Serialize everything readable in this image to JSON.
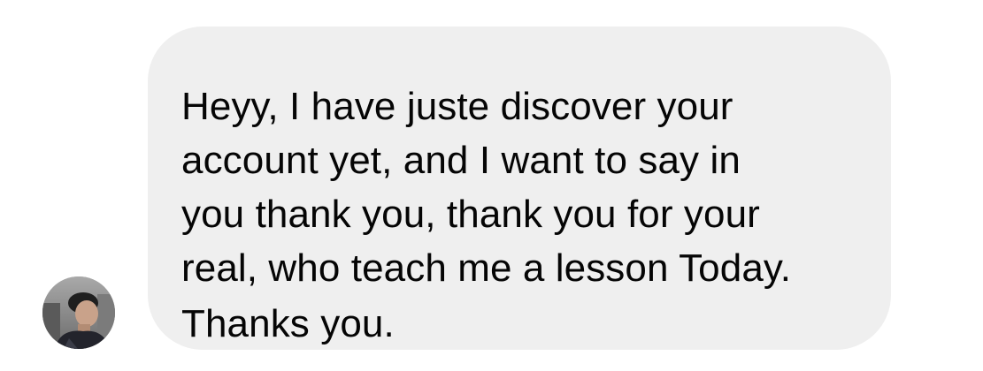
{
  "conversation": {
    "sender": {
      "avatar_icon": "user-avatar-photo"
    },
    "message": {
      "lines": [
        "Heyy, I have juste discover your",
        "account yet, and I want to say in",
        "you thank you, thank you for your",
        "real, who teach me a lesson Today.",
        "Thanks you."
      ]
    },
    "colors": {
      "bubble_background": "#efefef",
      "text": "#050505",
      "page_background": "#ffffff"
    }
  }
}
